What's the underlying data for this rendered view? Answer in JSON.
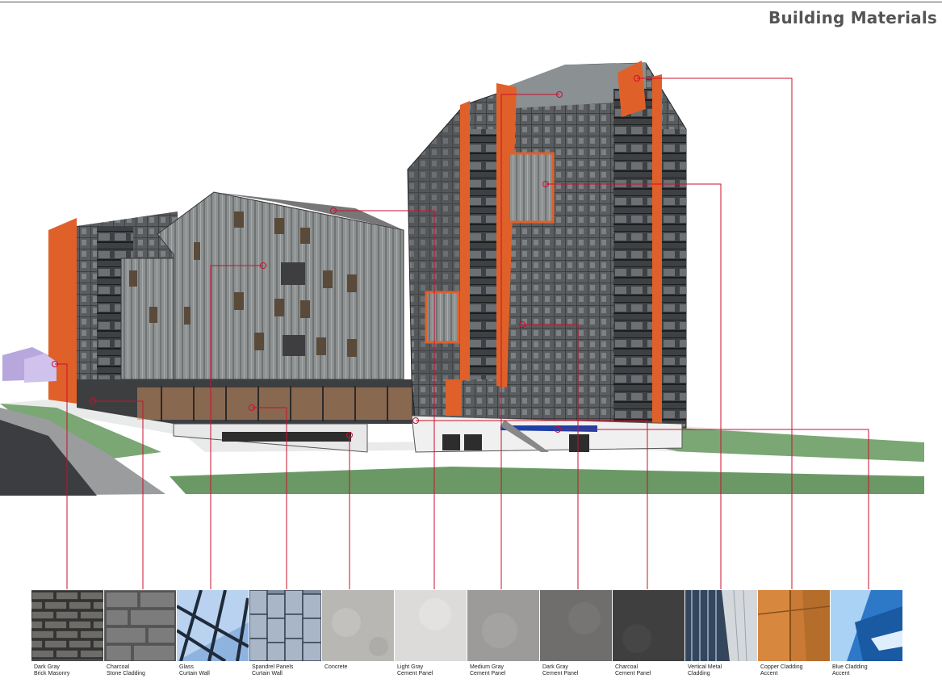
{
  "title": "Building Materials",
  "accent_color": "#c8102e",
  "materials": [
    {
      "line1": "Dark Gray",
      "line2": "Brick Masonry"
    },
    {
      "line1": "Charcoal",
      "line2": "Stone Cladding"
    },
    {
      "line1": "Glass",
      "line2": "Curtain Wall"
    },
    {
      "line1": "Spandrel Panels",
      "line2": "Curtain Wall"
    },
    {
      "line1": "Concrete",
      "line2": ""
    },
    {
      "line1": "Light Gray",
      "line2": "Cement Panel"
    },
    {
      "line1": "Medium Gray",
      "line2": "Cement Panel"
    },
    {
      "line1": "Dark Gray",
      "line2": "Cement Panel"
    },
    {
      "line1": "Charcoal",
      "line2": "Cement Panel"
    },
    {
      "line1": "Vertical Metal",
      "line2": "Cladding"
    },
    {
      "line1": "Copper Cladding",
      "line2": "Accent"
    },
    {
      "line1": "Blue Cladding",
      "line2": "Accent"
    }
  ]
}
